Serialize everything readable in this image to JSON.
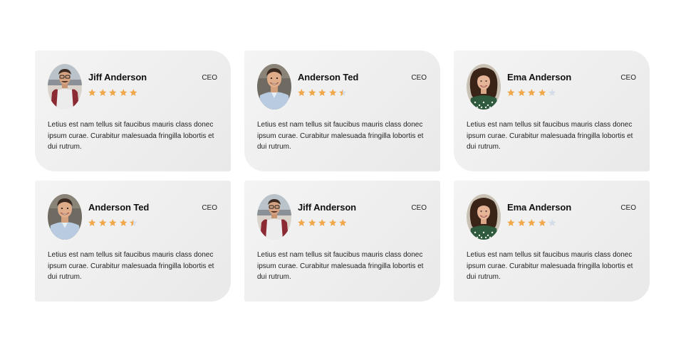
{
  "colors": {
    "star_filled": "#f0a84a",
    "star_empty": "#d4dde8",
    "card_bg_start": "#f4f4f4",
    "card_bg_end": "#e9e9e9"
  },
  "testimonials": [
    {
      "name": "Jiff Anderson",
      "role": "CEO",
      "rating": 5,
      "avatar": "man-glasses-avatar",
      "text": "Letius est nam tellus sit faucibus mauris class donec ipsum curae. Curabitur malesuada fringilla lobortis et dui rutrum."
    },
    {
      "name": "Anderson Ted",
      "role": "CEO",
      "rating": 4.5,
      "avatar": "man-smiling-avatar",
      "text": "Letius est nam tellus sit faucibus mauris class donec ipsum curae. Curabitur malesuada fringilla lobortis et dui rutrum."
    },
    {
      "name": "Ema Anderson",
      "role": "CEO",
      "rating": 4,
      "avatar": "woman-curly-avatar",
      "text": "Letius est nam tellus sit faucibus mauris class donec ipsum curae. Curabitur malesuada fringilla lobortis et dui rutrum."
    },
    {
      "name": "Anderson Ted",
      "role": "CEO",
      "rating": 4.5,
      "avatar": "man-smiling-avatar",
      "text": "Letius est nam tellus sit faucibus mauris class donec ipsum curae. Curabitur malesuada fringilla lobortis et dui rutrum."
    },
    {
      "name": "Jiff Anderson",
      "role": "CEO",
      "rating": 5,
      "avatar": "man-glasses-avatar",
      "text": "Letius est nam tellus sit faucibus mauris class donec ipsum curae. Curabitur malesuada fringilla lobortis et dui rutrum."
    },
    {
      "name": "Ema Anderson",
      "role": "CEO",
      "rating": 4,
      "avatar": "woman-curly-avatar",
      "text": "Letius est nam tellus sit faucibus mauris class donec ipsum curae. Curabitur malesuada fringilla lobortis et dui rutrum."
    }
  ]
}
